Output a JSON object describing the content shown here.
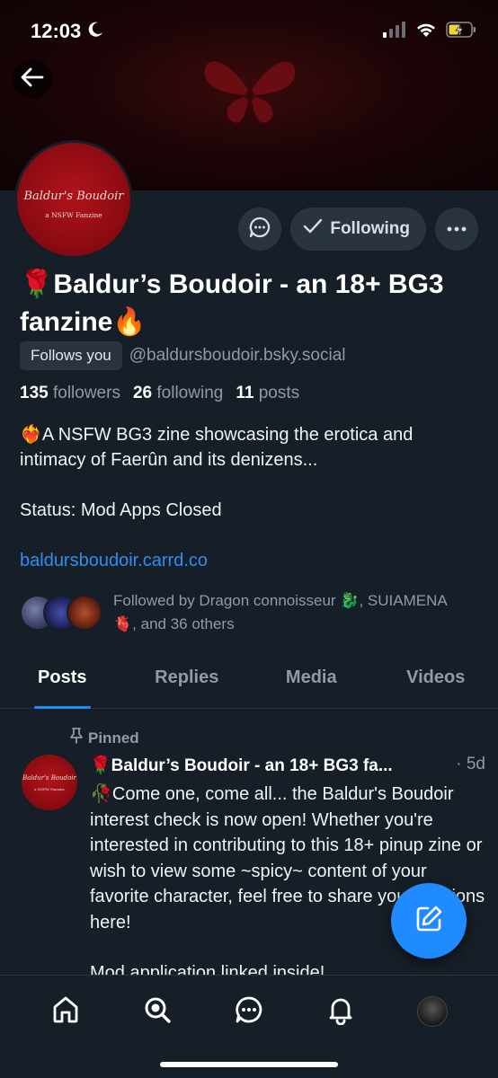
{
  "status_bar": {
    "time": "12:03"
  },
  "profile": {
    "avatar_line1": "Baldur's Boudoir",
    "avatar_line2": "a NSFW Fanzine",
    "display_name": "🌹Baldur’s Boudoir - an 18+ BG3 fanzine🔥",
    "follows_you": "Follows you",
    "handle": "@baldursboudoir.bsky.social",
    "stats": {
      "followers_count": "135",
      "followers_label": "followers",
      "following_count": "26",
      "following_label": "following",
      "posts_count": "11",
      "posts_label": "posts"
    },
    "bio_line1": "❤️‍🔥A NSFW BG3 zine showcasing the erotica and intimacy of Faerûn and its denizens...",
    "bio_line2": "Status: Mod Apps Closed",
    "bio_link": "baldursboudoir.carrd.co",
    "followed_by": "Followed by Dragon connoisseur 🐉, SUIAMENA🫀, and 36 others"
  },
  "actions": {
    "following_label": "Following"
  },
  "tabs": [
    {
      "label": "Posts"
    },
    {
      "label": "Replies"
    },
    {
      "label": "Media"
    },
    {
      "label": "Videos"
    }
  ],
  "post": {
    "pinned_label": "Pinned",
    "author": "🌹Baldur’s Boudoir - an 18+ BG3 fa...",
    "time": "· 5d",
    "avatar_line1": "Baldur's Boudoir",
    "avatar_line2": "a NSFW Fanzine",
    "body_p1": "🥀Come one, come all... the Baldur's Boudoir interest check is now open! Whether you're interested in contributing to this 18+ pinup zine or wish to view some ~spicy~ content of your favorite character, feel free to share your opinions here!",
    "body_p2": "Mod application linked inside!"
  },
  "colors": {
    "accent": "#208bfe",
    "background": "#161e27",
    "muted": "#8f9bab",
    "link": "#2e8ff2"
  },
  "icons": [
    "back-arrow-icon",
    "message-icon",
    "check-icon",
    "more-icon",
    "pin-icon",
    "compose-icon",
    "home-icon",
    "search-icon",
    "chat-icon",
    "bell-icon"
  ]
}
